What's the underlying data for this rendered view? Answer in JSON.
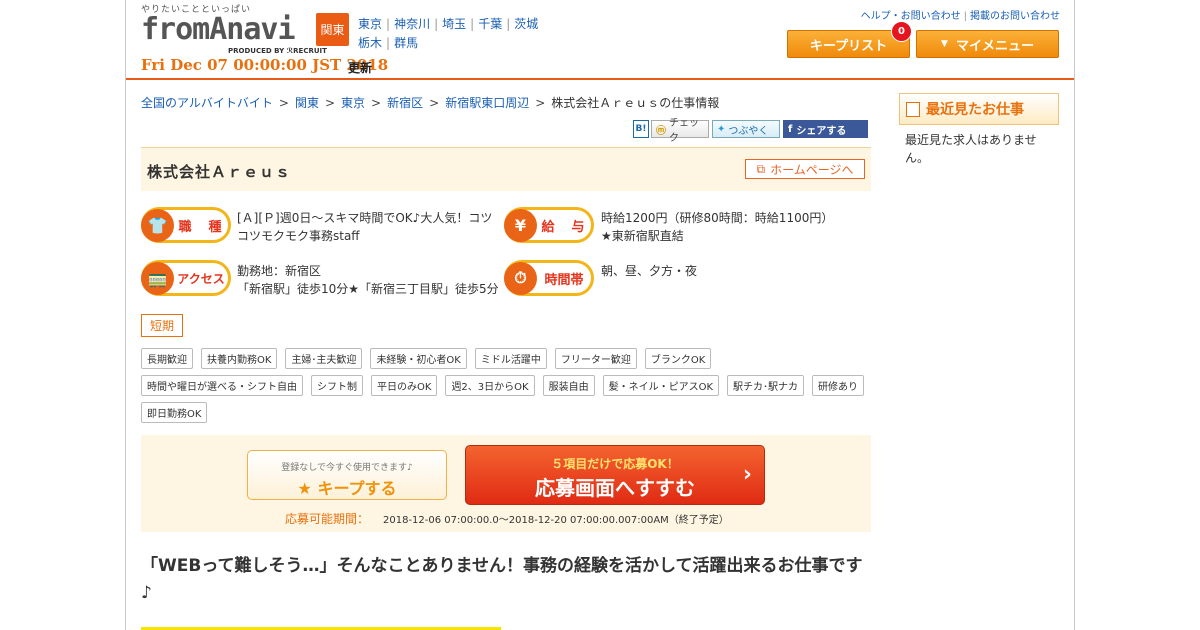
{
  "header": {
    "tagline": "やりたいことといっぱい",
    "logo_text": "fromAnavi",
    "produced_by": "PRODUCED BY ℛRECRUIT",
    "date": "Fri Dec 07 00:00:00 JST 2018",
    "date_suffix": "更新",
    "region": "関東",
    "prefectures_row1": [
      "東京",
      "神奈川",
      "埼玉",
      "千葉",
      "茨城"
    ],
    "prefectures_row2": [
      "栃木",
      "群馬"
    ],
    "help_link": "ヘルプ・お問い合わせ",
    "listing_link": "掲載のお問い合わせ",
    "keeplist_label": "キープリスト",
    "keeplist_count": "0",
    "mymenu_label": "マイメニュー"
  },
  "breadcrumb": [
    "全国のアルバイトバイト",
    "関東",
    "東京",
    "新宿区",
    "新宿駅東口周辺"
  ],
  "breadcrumb_current": "株式会社Ａｒｅｕｓの仕事情報",
  "social": {
    "hatena": "B!",
    "check": "チェック",
    "tweet": "つぶやく",
    "share": "シェアする"
  },
  "company": {
    "name": "株式会社Ａｒｅｕｓ",
    "homepage_button": "ホームページへ"
  },
  "job": {
    "type_label": "職　種",
    "type_value": "[Ａ][Ｐ]週0日～スキマ時間でOK♪大人気！コツコツモクモク事務staff",
    "salary_label": "給　与",
    "salary_value_1": "時給1200円（研修80時間：時給1100円）",
    "salary_value_2": "★東新宿駅直結",
    "access_label": "アクセス",
    "access_value_1": "勤務地：新宿区",
    "access_value_2": "「新宿駅」徒歩10分★「新宿三丁目駅」徒歩5分",
    "time_label": "時間帯",
    "time_value": "朝、昼、夕方・夜"
  },
  "term_badge": "短期",
  "tags": [
    "長期歓迎",
    "扶養内勤務OK",
    "主婦･主夫歓迎",
    "未経験・初心者OK",
    "ミドル活躍中",
    "フリーター歓迎",
    "ブランクOK",
    "時間や曜日が選べる・シフト自由",
    "シフト制",
    "平日のみOK",
    "週2、3日からOK",
    "服装自由",
    "髪・ネイル・ピアスOK",
    "駅チカ･駅ナカ",
    "研修あり",
    "即日勤務OK"
  ],
  "cta": {
    "keep_small": "登録なしで今すぐ使用できます♪",
    "keep_big": "キープする",
    "apply_small": "５項目だけで応募OK！",
    "apply_big": "応募画面へすすむ",
    "period_label": "応募可能期間：",
    "period_value": "2018-12-06 07:00:00.0～2018-12-20 07:00:00.007:00AM（終了予定）"
  },
  "headline": "「WEBって難しそう…」そんなことありません！事務の経験を活かして活躍出来るお仕事です♪",
  "sidebar": {
    "title": "最近見たお仕事",
    "empty_text": "最近見た求人はありません。"
  },
  "colors": {
    "accent": "#e85a16",
    "link": "#1a5fb4",
    "soft_bg": "#fef6e3"
  }
}
